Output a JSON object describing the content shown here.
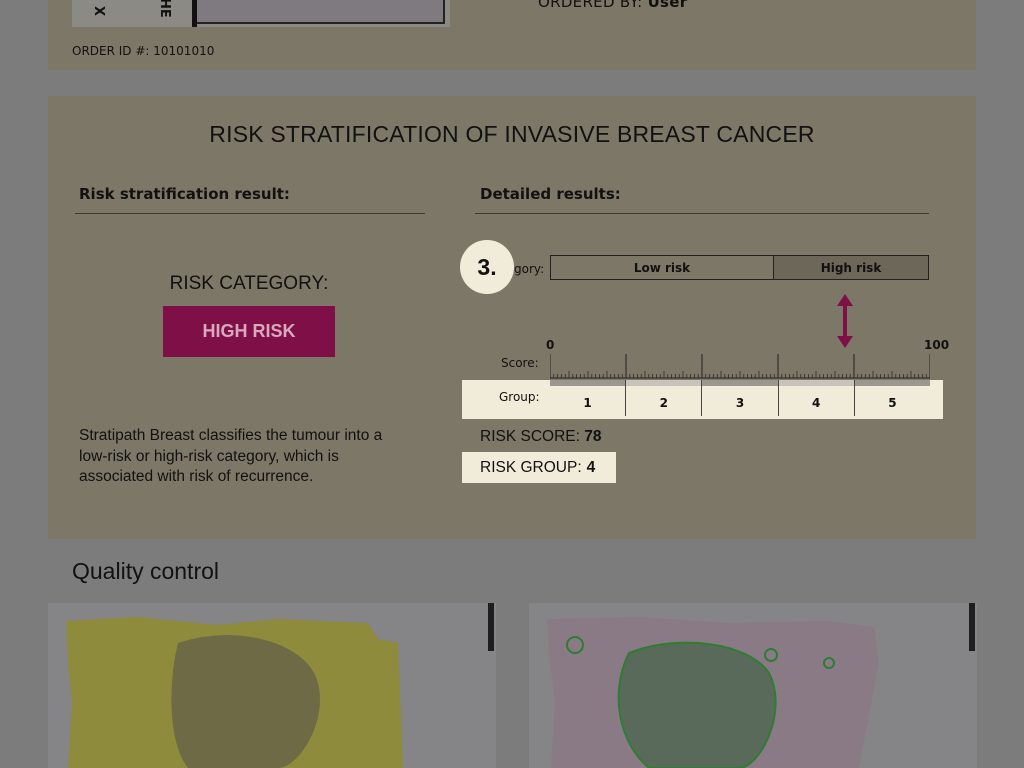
{
  "header": {
    "ordered_by_label": "ORDERED BY:",
    "ordered_by_value": "User",
    "order_id": "ORDER ID #: 10101010",
    "slide_label_1": "X",
    "slide_label_2": "HE"
  },
  "risk": {
    "title": "RISK STRATIFICATION OF INVASIVE BREAST CANCER",
    "left_heading": "Risk stratification result:",
    "right_heading": "Detailed results:",
    "category_label": "RISK CATEGORY:",
    "category_value": "HIGH RISK",
    "description": "Stratipath Breast classifies the tumour into a low-risk or high-risk category, which is associated with risk of recurrence.",
    "category_row_label": "gory:",
    "categories": [
      "Low risk",
      "High risk"
    ],
    "score_row_label": "Score:",
    "scale_min": "0",
    "scale_max": "100",
    "group_row_label": "Group:",
    "groups": [
      "1",
      "2",
      "3",
      "4",
      "5"
    ],
    "risk_score_label": "RISK SCORE:",
    "risk_score_value": "78",
    "risk_group_label": "RISK GROUP:",
    "risk_group_value": "4",
    "step_badge": "3.",
    "colors": {
      "high_risk": "#7e0f47",
      "arrow": "#7e0f47",
      "highlight": "#f1ecd9"
    }
  },
  "quality_control": {
    "title": "Quality control"
  }
}
